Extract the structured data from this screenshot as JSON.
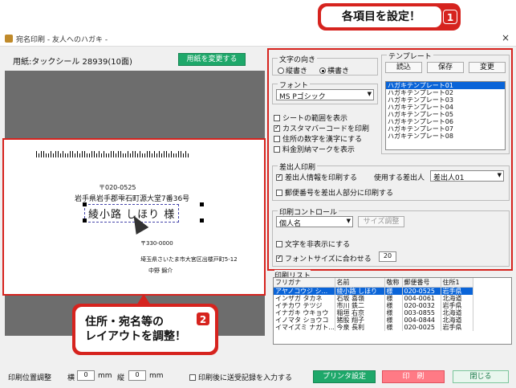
{
  "callout_top": {
    "text": "各項目を設定！",
    "num": "1"
  },
  "callout_bottom": {
    "line1": "住所・宛名等の",
    "line2": "レイアウトを調整！",
    "num": "2"
  },
  "window": {
    "title": "宛名印刷 - 友人へのハガキ -",
    "close": "×"
  },
  "paper": {
    "label": "用紙:タックシール 28939(10面)",
    "change_button": "用紙を変更する"
  },
  "sheet": {
    "zip1": "〒020-0525",
    "address1": "岩手県岩手郡雫石町源大堂7番36号",
    "name": "綾小路 しほり 様",
    "zip2": "〒330-0000",
    "address2": "埼玉県さいたま市大宮区出楼戸町5-12",
    "sender": "中野 錦介"
  },
  "settings": {
    "direction_title": "文字の向き",
    "vertical": "縦書き",
    "horizontal": "横書き",
    "font_title": "フォント",
    "font_value": "MS Pゴシック",
    "show_sheet_range": "シートの範囲を表示",
    "print_custom_barcode": "カスタマバーコードを印刷",
    "address_number_kanji": "住所の数字を漢字にする",
    "show_postage_mark": "料金別納マークを表示",
    "template_title": "テンプレート",
    "load": "読込",
    "save": "保存",
    "change": "変更",
    "templates": [
      "ハガキテンプレート01",
      "ハガキテンプレート02",
      "ハガキテンプレート03",
      "ハガキテンプレート04",
      "ハガキテンプレート05",
      "ハガキテンプレート06",
      "ハガキテンプレート07",
      "ハガキテンプレート08"
    ],
    "sender_title": "差出人印刷",
    "print_sender": "差出人情報を印刷する",
    "use_sender_label": "使用する差出人",
    "sender_value": "差出人01",
    "zip_in_sender": "郵便番号を差出人部分に印刷する",
    "print_control_title": "印刷コントロール",
    "control_value": "個人名",
    "size_adjust": "サイズ調整",
    "hide_text": "文字を非表示にする",
    "fit_font": "フォントサイズに合わせる",
    "fit_font_value": "20"
  },
  "print_list": {
    "title": "印刷リスト",
    "columns": [
      "フリガナ",
      "名前",
      "敬称",
      "郵便番号",
      "住所1"
    ],
    "rows": [
      [
        "アヤノコウジ シ...",
        "綾小路 しほり",
        "様",
        "020-0525",
        "岩手県"
      ],
      [
        "インザガ タカネ",
        "石坂 喜嶺",
        "様",
        "004-0061",
        "北海道"
      ],
      [
        "イチカワ テツジ",
        "市川 鉄二",
        "様",
        "020-0032",
        "岩手県"
      ],
      [
        "イナガキ ウキョウ",
        "稲垣 右京",
        "様",
        "003-0855",
        "北海道"
      ],
      [
        "イノマタ ショウコ",
        "猪股 翔子",
        "様",
        "004-0844",
        "北海道"
      ],
      [
        "イマイズミ ナガト...",
        "今泉 長利",
        "様",
        "020-0025",
        "岩手県"
      ]
    ]
  },
  "bottom": {
    "position_label": "印刷位置調整",
    "horiz": "横",
    "vert": "縦",
    "h_value": "0",
    "v_value": "0",
    "unit": "mm",
    "record_after_print": "印刷後に送受記録を入力する",
    "printer_settings": "プリンタ設定",
    "print": "印　刷",
    "close": "閉じる"
  }
}
